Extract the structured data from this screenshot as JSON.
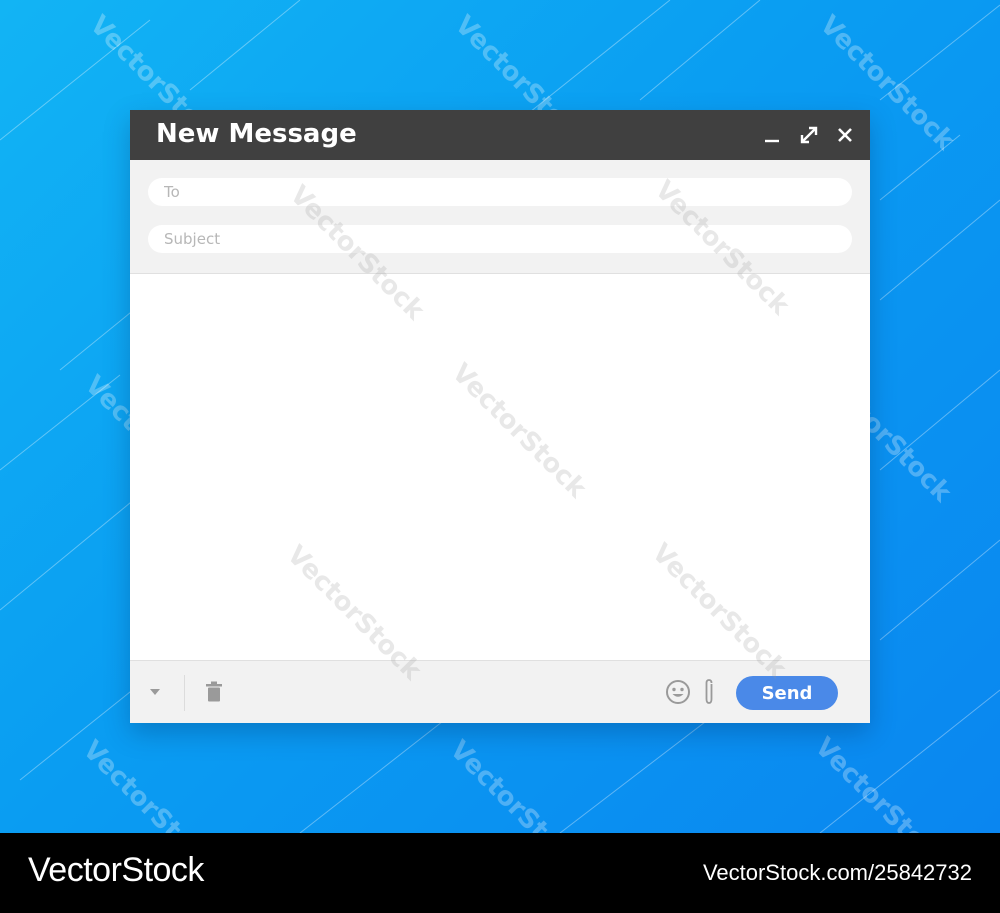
{
  "compose": {
    "title": "New Message",
    "to_placeholder": "To",
    "subject_placeholder": "Subject",
    "body_value": "",
    "send_label": "Send"
  },
  "icons": {
    "minimize": "minimize-icon",
    "maximize": "expand-icon",
    "close": "close-icon",
    "more": "chevron-down-icon",
    "discard": "trash-icon",
    "emoji": "emoji-icon",
    "attach": "paperclip-icon"
  },
  "watermark": {
    "text": "VectorStock",
    "brand": "VectorStock",
    "image_id": "VectorStock.com/25842732"
  },
  "colors": {
    "background_start": "#12b4f4",
    "background_end": "#0a86f0",
    "titlebar": "#404040",
    "panel": "#f2f2f2",
    "send_button": "#4a89e8",
    "footer_bar": "#000000"
  }
}
